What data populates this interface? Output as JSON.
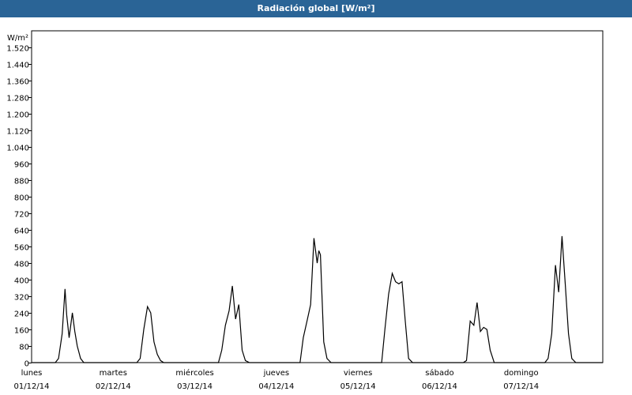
{
  "window": {
    "title": "Radiación global [W/m²]"
  },
  "chart_data": {
    "type": "line",
    "title": "Radiación global [W/m²]",
    "ylabel": "W/m²",
    "ylim": [
      0,
      1600
    ],
    "y_ticks": [
      0,
      80,
      160,
      240,
      320,
      400,
      480,
      560,
      640,
      720,
      800,
      880,
      960,
      1040,
      1120,
      1200,
      1280,
      1360,
      1440,
      1520
    ],
    "y_tick_labels": [
      "0",
      "80",
      "160",
      "240",
      "320",
      "400",
      "480",
      "560",
      "640",
      "720",
      "800",
      "880",
      "960",
      "1.040",
      "1.120",
      "1.200",
      "1.280",
      "1.360",
      "1.440",
      "1.520"
    ],
    "x_unit": "days since 01/12/14 00:00",
    "xlim": [
      0,
      7
    ],
    "grid": true,
    "days": [
      {
        "weekday": "lunes",
        "date": "01/12/14"
      },
      {
        "weekday": "martes",
        "date": "02/12/14"
      },
      {
        "weekday": "miércoles",
        "date": "03/12/14"
      },
      {
        "weekday": "jueves",
        "date": "04/12/14"
      },
      {
        "weekday": "viernes",
        "date": "05/12/14"
      },
      {
        "weekday": "sábado",
        "date": "06/12/14"
      },
      {
        "weekday": "domingo",
        "date": "07/12/14"
      }
    ],
    "series": [
      {
        "x": [
          0,
          0.29,
          0.33,
          0.375,
          0.41,
          0.43,
          0.46,
          0.5,
          0.53,
          0.56,
          0.6,
          0.64,
          0.67,
          0.7,
          1.29,
          1.33,
          1.375,
          1.42,
          1.46,
          1.5,
          1.54,
          1.58,
          1.62,
          1.67,
          1.71,
          2.29,
          2.33,
          2.375,
          2.42,
          2.46,
          2.5,
          2.54,
          2.58,
          2.62,
          2.67,
          2.71,
          3.29,
          3.33,
          3.375,
          3.42,
          3.46,
          3.5,
          3.52,
          3.54,
          3.58,
          3.62,
          3.67,
          3.71,
          4.29,
          4.33,
          4.375,
          4.42,
          4.46,
          4.5,
          4.54,
          4.58,
          4.62,
          4.67,
          4.71,
          5.29,
          5.33,
          5.375,
          5.42,
          5.46,
          5.5,
          5.54,
          5.58,
          5.62,
          5.67,
          5.71,
          6.29,
          6.33,
          6.375,
          6.42,
          6.46,
          6.5,
          6.54,
          6.58,
          6.62,
          6.67,
          6.71,
          7
        ],
        "y": [
          0,
          0,
          20,
          140,
          355,
          230,
          120,
          240,
          150,
          80,
          20,
          0,
          0,
          0,
          0,
          20,
          160,
          270,
          240,
          100,
          40,
          10,
          0,
          0,
          0,
          0,
          60,
          180,
          250,
          370,
          210,
          280,
          60,
          10,
          0,
          0,
          0,
          120,
          200,
          280,
          600,
          480,
          540,
          520,
          100,
          20,
          0,
          0,
          0,
          160,
          330,
          430,
          390,
          380,
          390,
          200,
          20,
          0,
          0,
          0,
          10,
          200,
          180,
          290,
          150,
          170,
          160,
          60,
          0,
          0,
          0,
          20,
          140,
          470,
          340,
          610,
          380,
          140,
          20,
          0,
          0,
          0
        ]
      }
    ]
  }
}
